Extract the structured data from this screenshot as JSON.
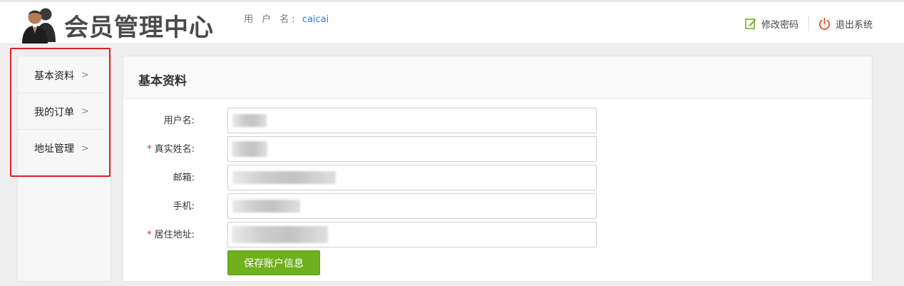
{
  "header": {
    "site_title": "会员管理中心",
    "username_label": "用 户 名:",
    "username": "caicai",
    "change_password": "修改密码",
    "logout": "退出系统"
  },
  "sidebar": {
    "items": [
      {
        "label": "基本资料",
        "chevron": ">"
      },
      {
        "label": "我的订单",
        "chevron": ">"
      },
      {
        "label": "地址管理",
        "chevron": ">"
      }
    ]
  },
  "main": {
    "title": "基本资料",
    "fields": [
      {
        "label": "用户名:",
        "required": false,
        "value": ""
      },
      {
        "label": "真实姓名:",
        "required": true,
        "value": ""
      },
      {
        "label": "邮箱:",
        "required": false,
        "value": ""
      },
      {
        "label": "手机:",
        "required": false,
        "value": ""
      },
      {
        "label": "居住地址:",
        "required": true,
        "value": ""
      }
    ],
    "required_mark": "*",
    "save_label": "保存账户信息"
  },
  "colors": {
    "accent_green": "#6fb01f",
    "link_blue": "#2b7bd6",
    "highlight_red": "#e02020",
    "logout_icon_red": "#e0501e"
  },
  "icons": {
    "logo": "user-pair-icon",
    "change_password": "edit-icon",
    "logout": "power-icon"
  }
}
